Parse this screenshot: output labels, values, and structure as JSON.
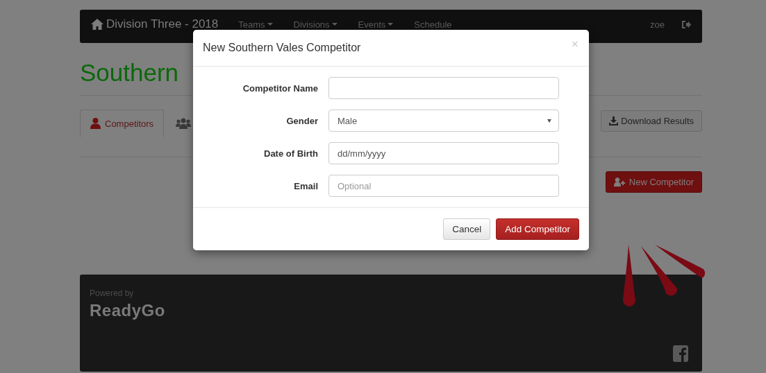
{
  "navbar": {
    "brand": "Division Three - 2018",
    "menus": [
      {
        "label": "Teams",
        "dropdown": true
      },
      {
        "label": "Divisions",
        "dropdown": true
      },
      {
        "label": "Events",
        "dropdown": true
      },
      {
        "label": "Schedule",
        "dropdown": false
      }
    ],
    "user": "zoe"
  },
  "page": {
    "title": "Southern",
    "tabs": [
      {
        "label": "Competitors",
        "selected": true
      },
      {
        "selected": false
      }
    ],
    "download_button": "Download Results",
    "new_button": "New Competitor"
  },
  "modal": {
    "title": "New Southern Vales Competitor",
    "close": "×",
    "fields": [
      {
        "label": "Competitor Name",
        "kind": "text"
      },
      {
        "label": "Gender",
        "kind": "select",
        "value": "Male"
      },
      {
        "label": "Date of Birth",
        "kind": "date",
        "placeholder": "dd/mm/yyyy"
      },
      {
        "label": "Email",
        "kind": "text",
        "placeholder": "Optional"
      }
    ],
    "buttons": [
      {
        "label": "Cancel",
        "kind": "default"
      },
      {
        "label": "Add Competitor",
        "kind": "primary"
      }
    ]
  },
  "footer": {
    "powered_by": "Powered by",
    "logo": "ReadyGo"
  }
}
